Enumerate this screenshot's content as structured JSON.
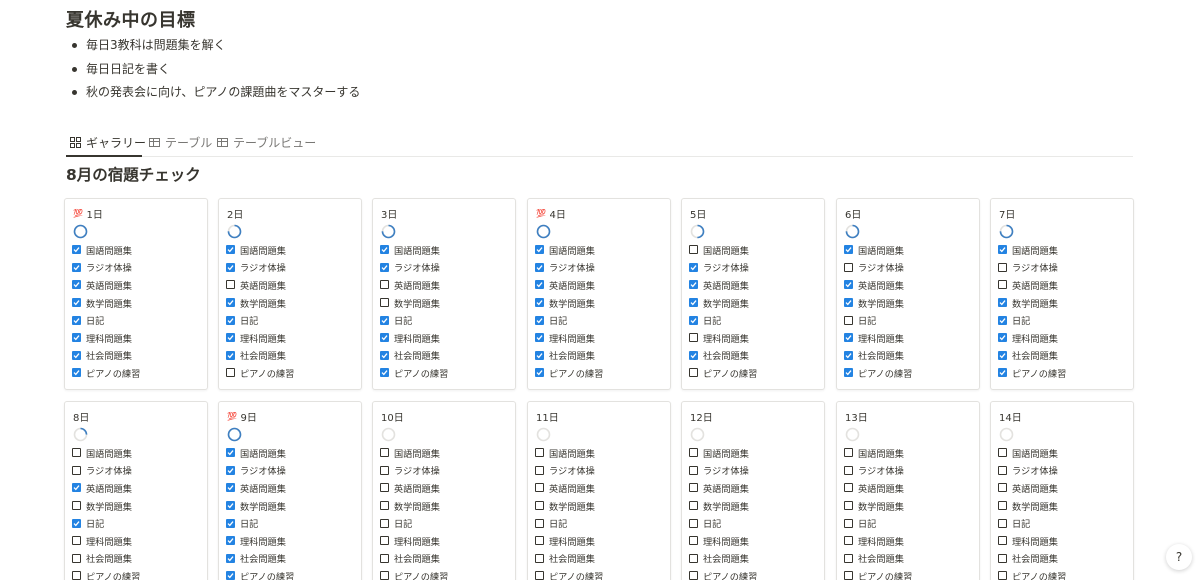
{
  "page": {
    "title": "夏休み中の目標",
    "goals": [
      "毎日3教科は問題集を解く",
      "毎日日記を書く",
      "秋の発表会に向け、ピアノの課題曲をマスターする"
    ]
  },
  "views": {
    "tabs": [
      {
        "label": "ギャラリー",
        "icon": "gallery-icon",
        "active": true
      },
      {
        "label": "テーブル",
        "icon": "table-icon",
        "active": false
      },
      {
        "label": "テーブルビュー",
        "icon": "table-icon",
        "active": false
      }
    ]
  },
  "gallery": {
    "title": "8月の宿題チェック",
    "task_labels": [
      "国語問題集",
      "ラジオ体操",
      "英語問題集",
      "数学問題集",
      "日記",
      "理科問題集",
      "社会問題集",
      "ピアノの練習"
    ],
    "cards": [
      {
        "day": "1日",
        "badge": "💯",
        "progress": 1.0,
        "checks": [
          true,
          true,
          true,
          true,
          true,
          true,
          true,
          true
        ]
      },
      {
        "day": "2日",
        "badge": "",
        "progress": 0.75,
        "checks": [
          true,
          true,
          false,
          true,
          true,
          true,
          true,
          false
        ]
      },
      {
        "day": "3日",
        "badge": "",
        "progress": 0.75,
        "checks": [
          true,
          true,
          false,
          false,
          true,
          true,
          true,
          true
        ]
      },
      {
        "day": "4日",
        "badge": "💯",
        "progress": 1.0,
        "checks": [
          true,
          true,
          true,
          true,
          true,
          true,
          true,
          true
        ]
      },
      {
        "day": "5日",
        "badge": "",
        "progress": 0.5,
        "checks": [
          false,
          true,
          true,
          true,
          true,
          false,
          true,
          false
        ]
      },
      {
        "day": "6日",
        "badge": "",
        "progress": 0.75,
        "checks": [
          true,
          false,
          true,
          true,
          false,
          true,
          true,
          true
        ]
      },
      {
        "day": "7日",
        "badge": "",
        "progress": 0.75,
        "checks": [
          true,
          false,
          false,
          true,
          true,
          true,
          true,
          true
        ]
      },
      {
        "day": "8日",
        "badge": "",
        "progress": 0.25,
        "checks": [
          false,
          false,
          true,
          false,
          true,
          false,
          false,
          false
        ]
      },
      {
        "day": "9日",
        "badge": "💯",
        "progress": 1.0,
        "checks": [
          true,
          true,
          true,
          true,
          true,
          true,
          true,
          true
        ]
      },
      {
        "day": "10日",
        "badge": "",
        "progress": 0,
        "checks": [
          false,
          false,
          false,
          false,
          false,
          false,
          false,
          false
        ]
      },
      {
        "day": "11日",
        "badge": "",
        "progress": 0,
        "checks": [
          false,
          false,
          false,
          false,
          false,
          false,
          false,
          false
        ]
      },
      {
        "day": "12日",
        "badge": "",
        "progress": 0,
        "checks": [
          false,
          false,
          false,
          false,
          false,
          false,
          false,
          false
        ]
      },
      {
        "day": "13日",
        "badge": "",
        "progress": 0,
        "checks": [
          false,
          false,
          false,
          false,
          false,
          false,
          false,
          false
        ]
      },
      {
        "day": "14日",
        "badge": "",
        "progress": 0,
        "checks": [
          false,
          false,
          false,
          false,
          false,
          false,
          false,
          false
        ]
      }
    ]
  },
  "help": {
    "label": "?"
  },
  "colors": {
    "accent": "#2383e2",
    "ring": "#3e7fc1",
    "ring_track": "#e3e2df",
    "badge": "#d4131f"
  }
}
